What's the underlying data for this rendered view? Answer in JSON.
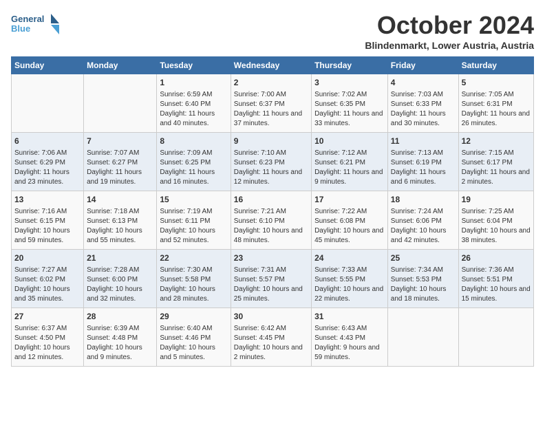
{
  "header": {
    "logo_line1": "General",
    "logo_line2": "Blue",
    "month": "October 2024",
    "location": "Blindenmarkt, Lower Austria, Austria"
  },
  "weekdays": [
    "Sunday",
    "Monday",
    "Tuesday",
    "Wednesday",
    "Thursday",
    "Friday",
    "Saturday"
  ],
  "weeks": [
    [
      {
        "day": "",
        "info": ""
      },
      {
        "day": "",
        "info": ""
      },
      {
        "day": "1",
        "info": "Sunrise: 6:59 AM\nSunset: 6:40 PM\nDaylight: 11 hours and 40 minutes."
      },
      {
        "day": "2",
        "info": "Sunrise: 7:00 AM\nSunset: 6:37 PM\nDaylight: 11 hours and 37 minutes."
      },
      {
        "day": "3",
        "info": "Sunrise: 7:02 AM\nSunset: 6:35 PM\nDaylight: 11 hours and 33 minutes."
      },
      {
        "day": "4",
        "info": "Sunrise: 7:03 AM\nSunset: 6:33 PM\nDaylight: 11 hours and 30 minutes."
      },
      {
        "day": "5",
        "info": "Sunrise: 7:05 AM\nSunset: 6:31 PM\nDaylight: 11 hours and 26 minutes."
      }
    ],
    [
      {
        "day": "6",
        "info": "Sunrise: 7:06 AM\nSunset: 6:29 PM\nDaylight: 11 hours and 23 minutes."
      },
      {
        "day": "7",
        "info": "Sunrise: 7:07 AM\nSunset: 6:27 PM\nDaylight: 11 hours and 19 minutes."
      },
      {
        "day": "8",
        "info": "Sunrise: 7:09 AM\nSunset: 6:25 PM\nDaylight: 11 hours and 16 minutes."
      },
      {
        "day": "9",
        "info": "Sunrise: 7:10 AM\nSunset: 6:23 PM\nDaylight: 11 hours and 12 minutes."
      },
      {
        "day": "10",
        "info": "Sunrise: 7:12 AM\nSunset: 6:21 PM\nDaylight: 11 hours and 9 minutes."
      },
      {
        "day": "11",
        "info": "Sunrise: 7:13 AM\nSunset: 6:19 PM\nDaylight: 11 hours and 6 minutes."
      },
      {
        "day": "12",
        "info": "Sunrise: 7:15 AM\nSunset: 6:17 PM\nDaylight: 11 hours and 2 minutes."
      }
    ],
    [
      {
        "day": "13",
        "info": "Sunrise: 7:16 AM\nSunset: 6:15 PM\nDaylight: 10 hours and 59 minutes."
      },
      {
        "day": "14",
        "info": "Sunrise: 7:18 AM\nSunset: 6:13 PM\nDaylight: 10 hours and 55 minutes."
      },
      {
        "day": "15",
        "info": "Sunrise: 7:19 AM\nSunset: 6:11 PM\nDaylight: 10 hours and 52 minutes."
      },
      {
        "day": "16",
        "info": "Sunrise: 7:21 AM\nSunset: 6:10 PM\nDaylight: 10 hours and 48 minutes."
      },
      {
        "day": "17",
        "info": "Sunrise: 7:22 AM\nSunset: 6:08 PM\nDaylight: 10 hours and 45 minutes."
      },
      {
        "day": "18",
        "info": "Sunrise: 7:24 AM\nSunset: 6:06 PM\nDaylight: 10 hours and 42 minutes."
      },
      {
        "day": "19",
        "info": "Sunrise: 7:25 AM\nSunset: 6:04 PM\nDaylight: 10 hours and 38 minutes."
      }
    ],
    [
      {
        "day": "20",
        "info": "Sunrise: 7:27 AM\nSunset: 6:02 PM\nDaylight: 10 hours and 35 minutes."
      },
      {
        "day": "21",
        "info": "Sunrise: 7:28 AM\nSunset: 6:00 PM\nDaylight: 10 hours and 32 minutes."
      },
      {
        "day": "22",
        "info": "Sunrise: 7:30 AM\nSunset: 5:58 PM\nDaylight: 10 hours and 28 minutes."
      },
      {
        "day": "23",
        "info": "Sunrise: 7:31 AM\nSunset: 5:57 PM\nDaylight: 10 hours and 25 minutes."
      },
      {
        "day": "24",
        "info": "Sunrise: 7:33 AM\nSunset: 5:55 PM\nDaylight: 10 hours and 22 minutes."
      },
      {
        "day": "25",
        "info": "Sunrise: 7:34 AM\nSunset: 5:53 PM\nDaylight: 10 hours and 18 minutes."
      },
      {
        "day": "26",
        "info": "Sunrise: 7:36 AM\nSunset: 5:51 PM\nDaylight: 10 hours and 15 minutes."
      }
    ],
    [
      {
        "day": "27",
        "info": "Sunrise: 6:37 AM\nSunset: 4:50 PM\nDaylight: 10 hours and 12 minutes."
      },
      {
        "day": "28",
        "info": "Sunrise: 6:39 AM\nSunset: 4:48 PM\nDaylight: 10 hours and 9 minutes."
      },
      {
        "day": "29",
        "info": "Sunrise: 6:40 AM\nSunset: 4:46 PM\nDaylight: 10 hours and 5 minutes."
      },
      {
        "day": "30",
        "info": "Sunrise: 6:42 AM\nSunset: 4:45 PM\nDaylight: 10 hours and 2 minutes."
      },
      {
        "day": "31",
        "info": "Sunrise: 6:43 AM\nSunset: 4:43 PM\nDaylight: 9 hours and 59 minutes."
      },
      {
        "day": "",
        "info": ""
      },
      {
        "day": "",
        "info": ""
      }
    ]
  ]
}
